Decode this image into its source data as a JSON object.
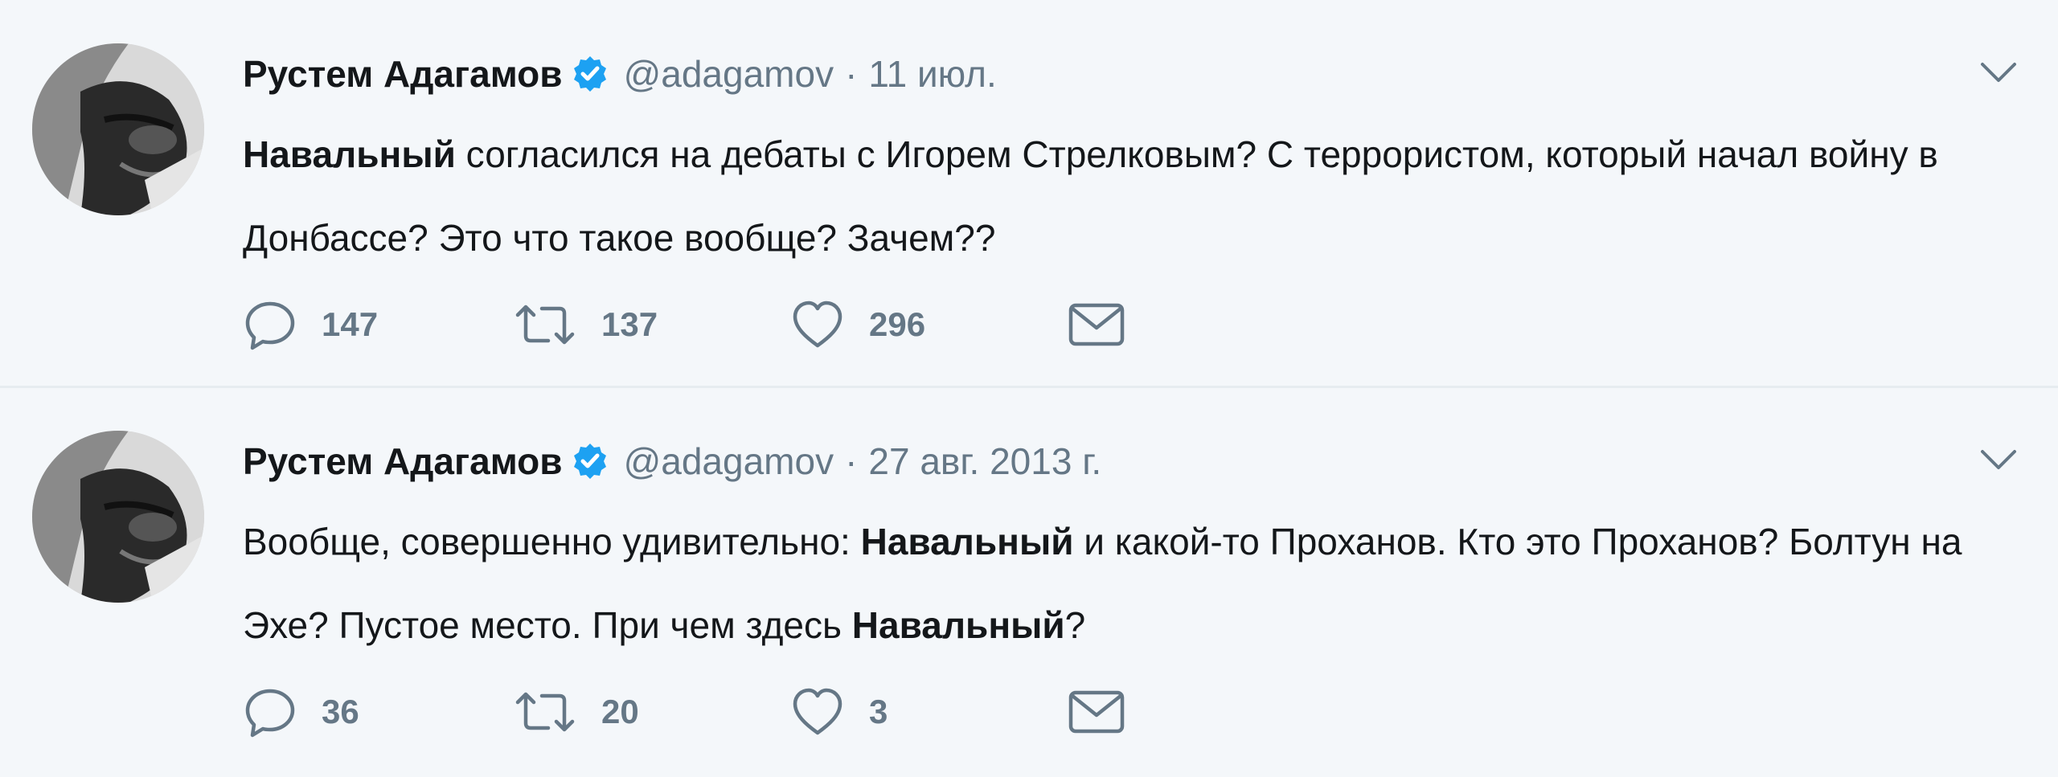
{
  "tweets": [
    {
      "author_name": "Рустем Адагамов",
      "author_handle": "@adagamov",
      "separator": "·",
      "date": "11 июл.",
      "text_segments": [
        {
          "bold": "Навальный"
        },
        {
          "plain": " согласился на дебаты с Игорем Стрелковым? С террористом, который начал войну в Донбассе? Это что такое вообще? Зачем??"
        }
      ],
      "replies": "147",
      "retweets": "137",
      "likes": "296"
    },
    {
      "author_name": "Рустем Адагамов",
      "author_handle": "@adagamov",
      "separator": "·",
      "date": "27 авг. 2013 г.",
      "text_segments": [
        {
          "plain": "Вообще, совершенно удивительно: "
        },
        {
          "bold": "Навальный"
        },
        {
          "plain": " и какой-то Проханов. Кто это Проханов? Болтун на Эхе? Пустое место. При чем здесь "
        },
        {
          "bold": "Навальный"
        },
        {
          "plain": "?"
        }
      ],
      "replies": "36",
      "retweets": "20",
      "likes": "3"
    }
  ],
  "icons": {
    "verified": "verified-badge-icon",
    "caret": "chevron-down-icon",
    "reply": "reply-icon",
    "retweet": "retweet-icon",
    "like": "heart-icon",
    "dm": "envelope-icon"
  },
  "colors": {
    "background": "#f4f7fa",
    "name": "#14171a",
    "secondary": "#657786",
    "verified": "#1da1f2",
    "divider": "#e6ecf0"
  }
}
